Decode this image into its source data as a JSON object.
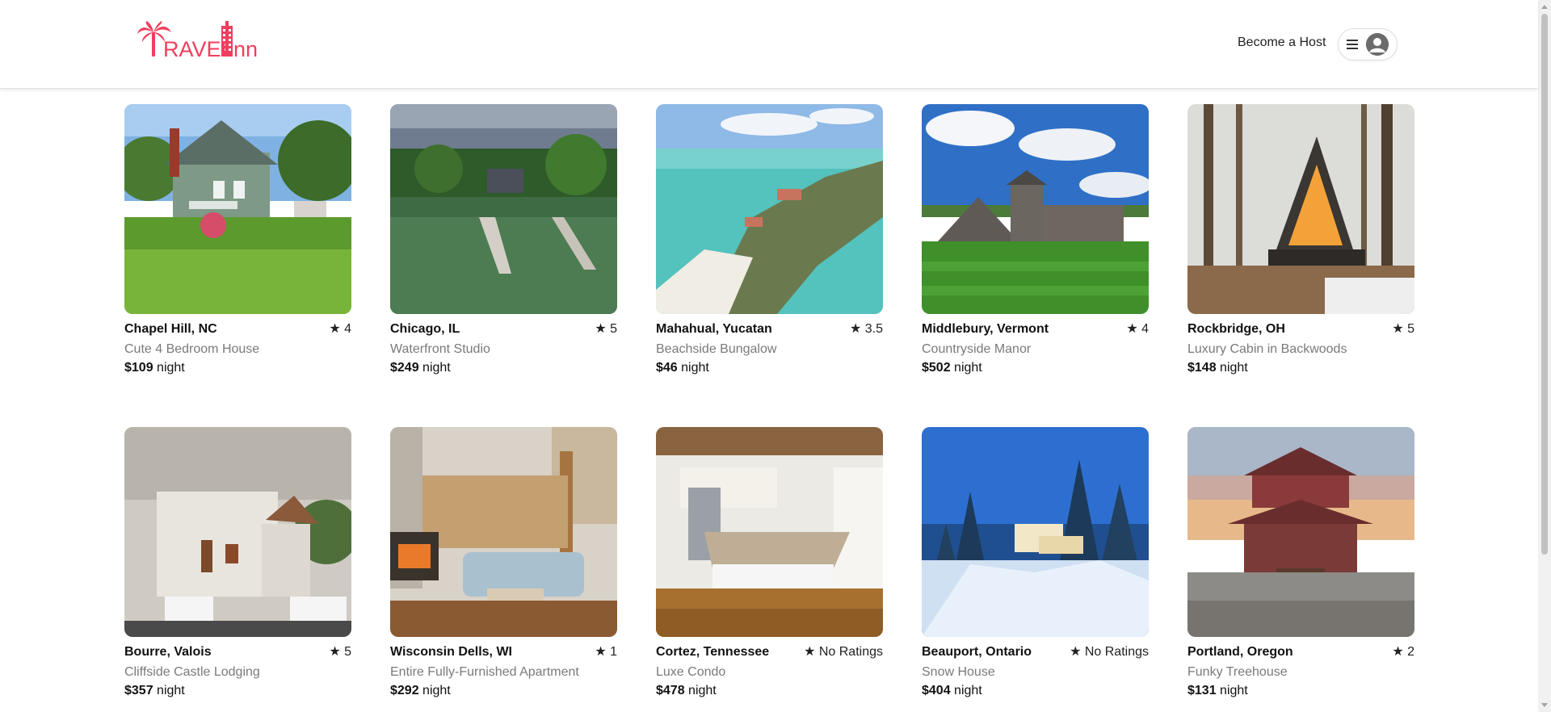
{
  "header": {
    "logo_text": "RAVELINN",
    "logo_display": "TravelInn",
    "become_host": "Become a Host",
    "brand_color": "#ef3f5e"
  },
  "icons": {
    "menu": "hamburger-menu-icon",
    "user": "user-avatar-icon",
    "star": "star-icon"
  },
  "listings": [
    {
      "city": "Chapel Hill, NC",
      "rating": "★ 4",
      "title": "Cute 4 Bedroom House",
      "price": "$109",
      "unit": " night"
    },
    {
      "city": "Chicago, IL",
      "rating": "★ 5",
      "title": "Waterfront Studio",
      "price": "$249",
      "unit": " night"
    },
    {
      "city": "Mahahual, Yucatan",
      "rating": "★ 3.5",
      "title": "Beachside Bungalow",
      "price": "$46",
      "unit": " night"
    },
    {
      "city": "Middlebury, Vermont",
      "rating": "★ 4",
      "title": "Countryside Manor",
      "price": "$502",
      "unit": " night"
    },
    {
      "city": "Rockbridge, OH",
      "rating": "★ 5",
      "title": "Luxury Cabin in Backwoods",
      "price": "$148",
      "unit": " night"
    },
    {
      "city": "Bourre, Valois",
      "rating": "★ 5",
      "title": "Cliffside Castle Lodging",
      "price": "$357",
      "unit": " night"
    },
    {
      "city": "Wisconsin Dells, WI",
      "rating": "★ 1",
      "title": "Entire Fully-Furnished Apartment",
      "price": "$292",
      "unit": " night"
    },
    {
      "city": "Cortez, Tennessee",
      "rating": "★ No Ratings",
      "title": "Luxe Condo",
      "price": "$478",
      "unit": " night"
    },
    {
      "city": "Beauport, Ontario",
      "rating": "★ No Ratings",
      "title": "Snow House",
      "price": "$404",
      "unit": " night"
    },
    {
      "city": "Portland, Oregon",
      "rating": "★ 2",
      "title": "Funky Treehouse",
      "price": "$131",
      "unit": " night"
    }
  ]
}
